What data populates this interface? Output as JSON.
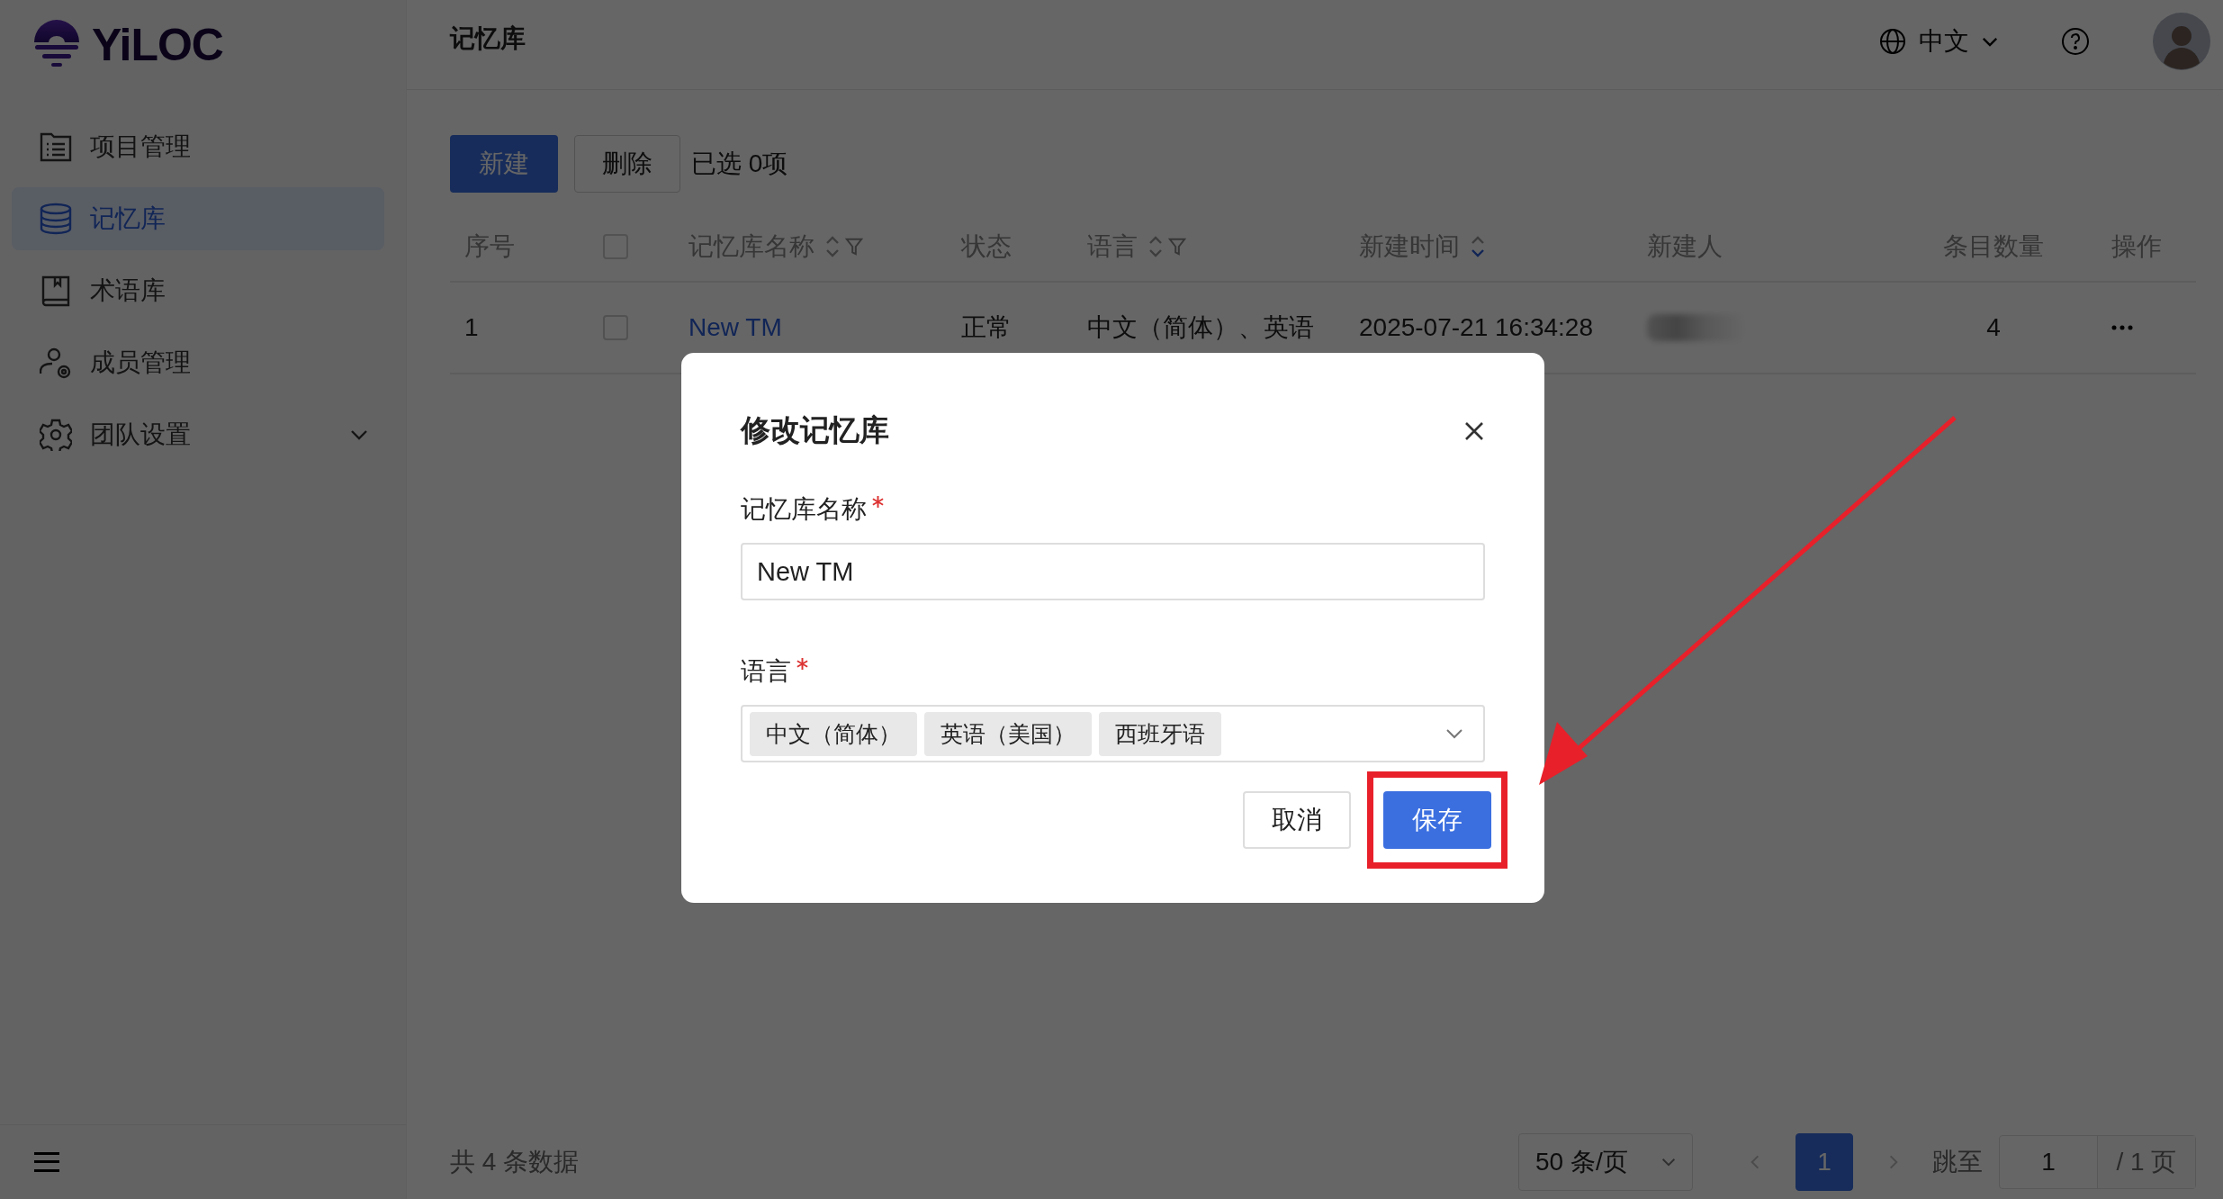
{
  "app": {
    "logo": "YiLOC"
  },
  "sidebar": {
    "items": [
      {
        "label": "项目管理",
        "kind": "folder",
        "selected": false,
        "has_submenu": false
      },
      {
        "label": "记忆库",
        "kind": "database",
        "selected": true,
        "has_submenu": false
      },
      {
        "label": "术语库",
        "kind": "book",
        "selected": false,
        "has_submenu": false
      },
      {
        "label": "成员管理",
        "kind": "members",
        "selected": false,
        "has_submenu": false
      },
      {
        "label": "团队设置",
        "kind": "gear",
        "selected": false,
        "has_submenu": true
      }
    ]
  },
  "header": {
    "title": "记忆库",
    "language": "中文"
  },
  "toolbar": {
    "buttons": [
      {
        "label": "新建",
        "kind": "primary"
      },
      {
        "label": "删除",
        "kind": "default"
      }
    ],
    "selection_count": "已选 0项"
  },
  "table": {
    "select_all_checked": false,
    "columns": [
      {
        "label": "序号",
        "sortable": false,
        "filterable": false,
        "sorted_descending": false
      },
      {
        "label": "记忆库名称",
        "sortable": true,
        "filterable": true,
        "sorted_descending": false
      },
      {
        "label": "状态",
        "sortable": false,
        "filterable": false,
        "sorted_descending": false
      },
      {
        "label": "语言",
        "sortable": true,
        "filterable": true,
        "sorted_descending": false
      },
      {
        "label": "新建时间",
        "sortable": true,
        "filterable": false,
        "sorted_descending": true
      },
      {
        "label": "新建人",
        "sortable": false,
        "filterable": false,
        "sorted_descending": false
      },
      {
        "label": "条目数量",
        "sortable": false,
        "filterable": false,
        "sorted_descending": false
      },
      {
        "label": "操作",
        "sortable": false,
        "filterable": false,
        "sorted_descending": false
      }
    ],
    "rows": [
      {
        "index": "1",
        "checked": false,
        "name": "New TM",
        "status": "正常",
        "languages": "中文（简体）、英语",
        "created": "2025-07-21 16:34:28",
        "count": "4"
      }
    ]
  },
  "pagination": {
    "summary": "共 4 条数据",
    "page_size": "50 条/页",
    "pages": [
      {
        "label": "1",
        "selected": true
      }
    ],
    "jump_label": "跳至",
    "jump_value": "1",
    "total_pages": "/ 1 页"
  },
  "dialog": {
    "title": "修改记忆库",
    "fields": [
      {
        "label": "记忆库名称",
        "required": true,
        "kind": "text",
        "value": "New TM"
      },
      {
        "label": "语言",
        "required": true,
        "kind": "tags",
        "tags": [
          "中文（简体）",
          "英语（美国）",
          "西班牙语"
        ]
      }
    ],
    "buttons": [
      {
        "label": "取消",
        "kind": "default",
        "highlighted": false
      },
      {
        "label": "保存",
        "kind": "primary",
        "highlighted": true
      }
    ]
  }
}
